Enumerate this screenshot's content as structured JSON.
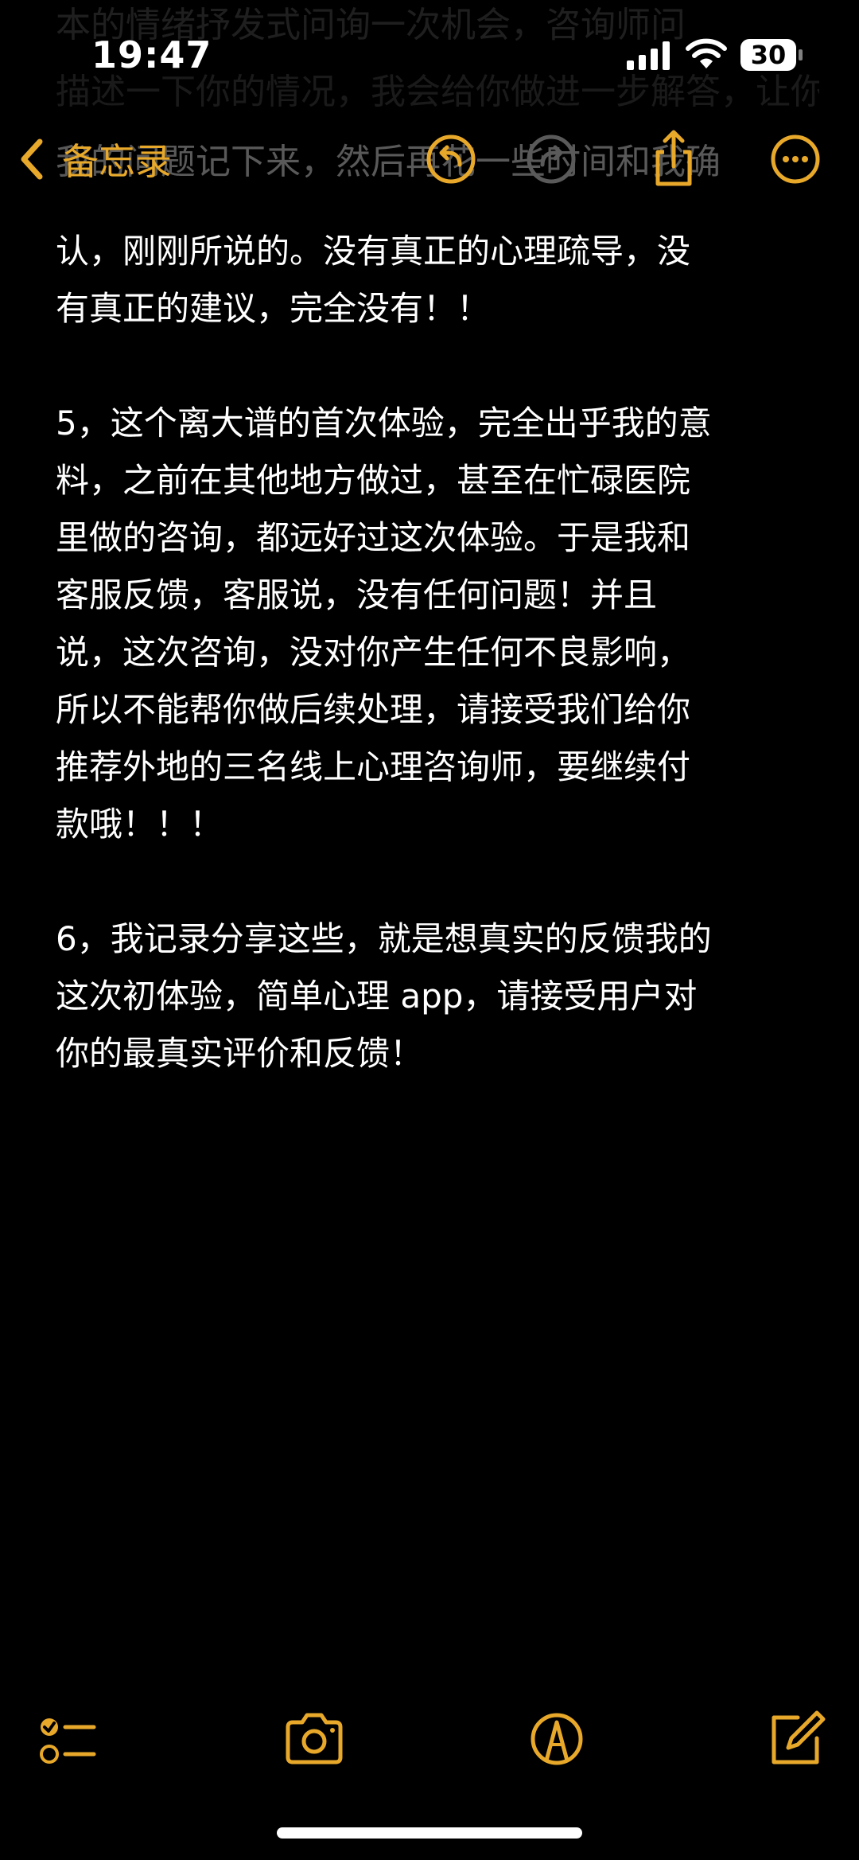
{
  "status_bar": {
    "time": "19:47",
    "battery_level": "30",
    "icons": [
      "signal-icon",
      "wifi-icon",
      "battery-icon"
    ]
  },
  "nav": {
    "back_label": "备忘录",
    "icons": [
      "chevron-left-icon",
      "undo-icon",
      "redo-icon",
      "share-icon",
      "more-icon"
    ],
    "accent_color": "#E8A92B"
  },
  "ghost_text": {
    "top": "本的情绪抒发式问询一次机会，咨询师问",
    "line1": "描述一下你的情况，我会给你做进一步解答，让你",
    "line2": "我的问题记下来，然后再花一些时间和我确"
  },
  "note": {
    "paragraphs": [
      {
        "lines": [
          "认，刚刚所说的。没有真正的心理疏导，没",
          "有真正的建议，完全没有！！"
        ]
      },
      {
        "lines": [
          "5，这个离大谱的首次体验，完全出乎我的意",
          "料，之前在其他地方做过，甚至在忙碌医院",
          "里做的咨询，都远好过这次体验。于是我和",
          "客服反馈，客服说，没有任何问题！并且",
          "说，这次咨询，没对你产生任何不良影响，",
          "所以不能帮你做后续处理，请接受我们给你",
          "推荐外地的三名线上心理咨询师，要继续付",
          "款哦！！！"
        ]
      },
      {
        "lines": [
          "6，我记录分享这些，就是想真实的反馈我的",
          "这次初体验，简单心理 app，请接受用户对",
          "你的最真实评价和反馈！"
        ]
      }
    ]
  },
  "toolbar": {
    "icons": [
      "checklist-icon",
      "camera-icon",
      "markup-icon",
      "compose-icon"
    ]
  }
}
